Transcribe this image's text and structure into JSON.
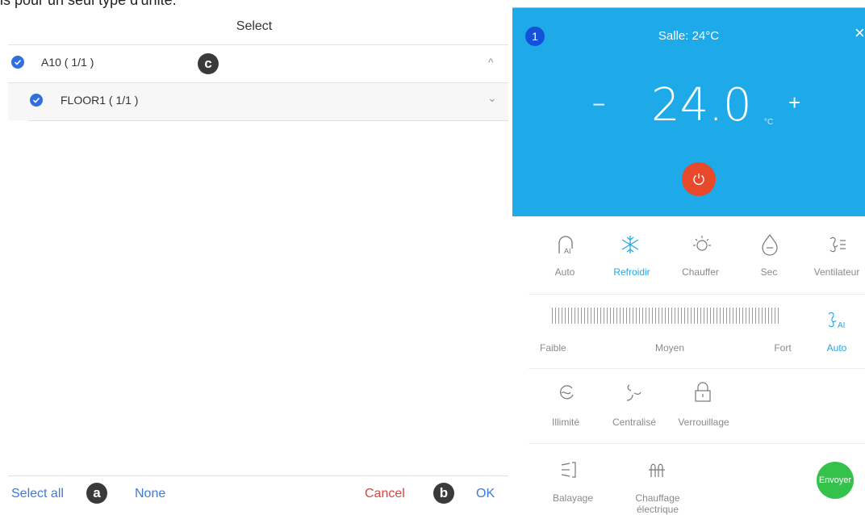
{
  "top_text": "is pour un seul type d'unité.",
  "select_panel": {
    "title": "Select",
    "rows": [
      {
        "label": "A10 ( 1/1 )",
        "chevron": "^"
      },
      {
        "label": "FLOOR1 ( 1/1 )",
        "chevron": "⌄"
      }
    ],
    "markers": {
      "a": "a",
      "b": "b",
      "c": "c"
    },
    "footer": {
      "select_all": "Select all",
      "none": "None",
      "cancel": "Cancel",
      "ok": "OK"
    },
    "colors": {
      "link": "#3b7bdc",
      "cancel": "#e0413c",
      "check": "#2f6fe0"
    }
  },
  "ac_panel": {
    "badge": "1",
    "room": "Salle: 24°C",
    "close": "×",
    "minus": "−",
    "temperature": "24.0",
    "unit": "°C",
    "plus": "+",
    "modes": [
      {
        "icon": "auto-ai-icon",
        "label": "Auto",
        "active": false
      },
      {
        "icon": "snowflake-icon",
        "label": "Refroidir",
        "active": true
      },
      {
        "icon": "sun-icon",
        "label": "Chauffer",
        "active": false
      },
      {
        "icon": "drop-icon",
        "label": "Sec",
        "active": false
      },
      {
        "icon": "fan-icon",
        "label": "Ventilateur",
        "active": false
      }
    ],
    "fan": {
      "low": "Faible",
      "mid": "Moyen",
      "high": "Fort",
      "auto": "Auto"
    },
    "options": [
      {
        "icon": "unlimited-icon",
        "label": "Illimité"
      },
      {
        "icon": "centralized-icon",
        "label": "Centralisé"
      },
      {
        "icon": "lock-icon",
        "label": "Verrouillage"
      }
    ],
    "bottom": [
      {
        "icon": "swing-icon",
        "label": "Balayage"
      },
      {
        "icon": "electric-heat-icon",
        "label": "Chauffage électrique"
      }
    ],
    "send": "Envoyer",
    "colors": {
      "header": "#1ea9e9",
      "power": "#e8492b",
      "active": "#1ea9e9",
      "send": "#35c24a"
    }
  }
}
